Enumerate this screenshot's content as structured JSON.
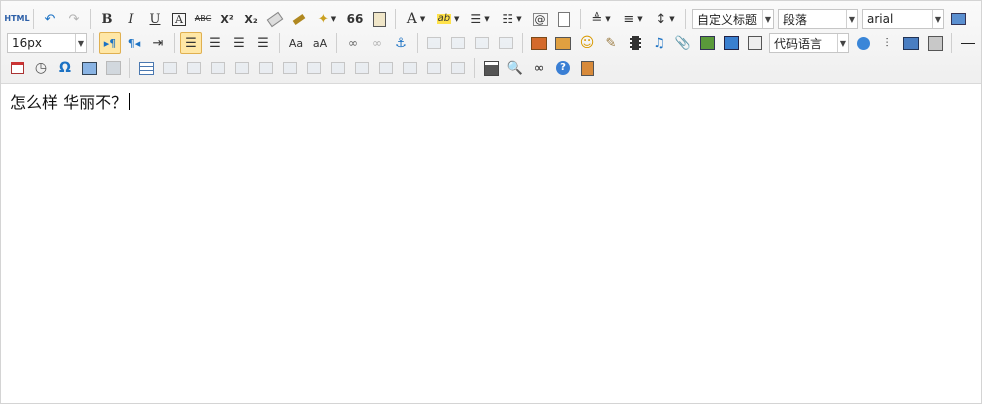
{
  "toolbar": {
    "row1": {
      "html_source_label": "HTML",
      "undo_glyph": "↶",
      "redo_glyph": "↷",
      "bold_label": "B",
      "italic_label": "I",
      "underline_label": "U",
      "font_border_label": "A",
      "strikethrough_label": "ABC",
      "superscript_label": "X²",
      "subscript_label": "X₂",
      "quote_label": "66",
      "font_color_label": "A",
      "background_color_label": "ab",
      "heading_dropdown": "自定义标题",
      "paragraph_dropdown": "段落",
      "font_family_dropdown": "arial"
    },
    "row2": {
      "font_size_dropdown": "16px",
      "code_language_dropdown": "代码语言"
    }
  },
  "content": {
    "text": "怎么样 华丽不？"
  }
}
